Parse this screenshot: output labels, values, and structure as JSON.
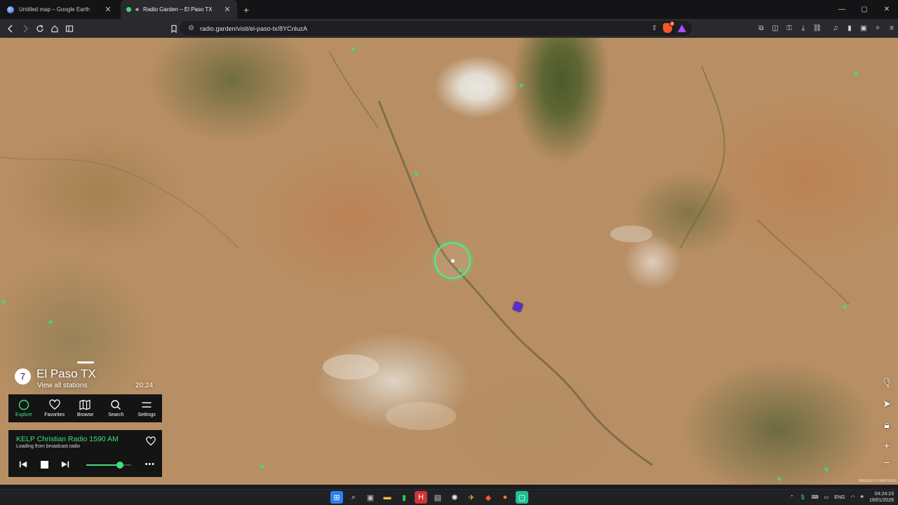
{
  "browser": {
    "tabs": [
      {
        "title": "Untitled map – Google Earth",
        "active": false
      },
      {
        "title": "Radio Garden – El Paso TX",
        "active": true
      }
    ],
    "url": "radio.garden/visit/el-paso-tx/8YCnluzA",
    "brave_shield_count": "2"
  },
  "location": {
    "count": "7",
    "name": "El Paso TX",
    "view_all": "View all stations",
    "local_time": "20:24"
  },
  "nav": [
    {
      "label": "Explore",
      "icon": "compass-icon"
    },
    {
      "label": "Favorites",
      "icon": "heart-icon"
    },
    {
      "label": "Browse",
      "icon": "map-icon"
    },
    {
      "label": "Search",
      "icon": "search-icon"
    },
    {
      "label": "Settings",
      "icon": "menu-icon"
    }
  ],
  "player": {
    "station": "KELP Christian Radio 1590 AM",
    "status": "Loading from broadcast.radio",
    "volume": 0.75
  },
  "map": {
    "credit": "IMAGERY © MAPTILER"
  },
  "taskbar": {
    "lang": "ENG",
    "time": "04:24:23",
    "date": "19/01/2026"
  },
  "colors": {
    "accent": "#3ee07c",
    "panel": "#141414",
    "pin": "#5b2bd6"
  }
}
